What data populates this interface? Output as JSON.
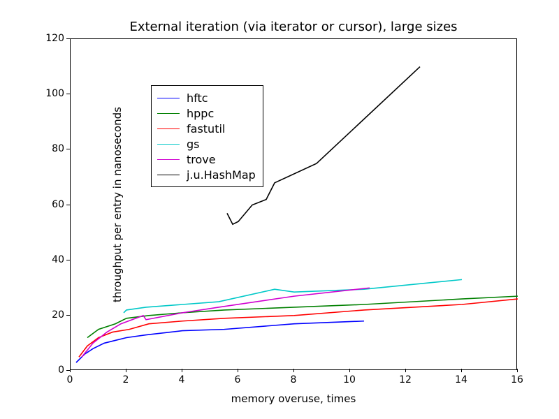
{
  "chart_data": {
    "type": "line",
    "title": "External iteration (via iterator or cursor), large sizes",
    "xlabel": "memory overuse, times",
    "ylabel": "throughput per entry in nanoseconds",
    "xlim": [
      0,
      16
    ],
    "ylim": [
      0,
      120
    ],
    "xticks": [
      0,
      2,
      4,
      6,
      8,
      10,
      12,
      14,
      16
    ],
    "yticks": [
      0,
      20,
      40,
      60,
      80,
      100,
      120
    ],
    "series": [
      {
        "name": "hftc",
        "color": "#0000ff",
        "x": [
          0.2,
          0.5,
          0.8,
          1.2,
          1.6,
          2.0,
          2.7,
          4.0,
          5.5,
          8.0,
          10.5
        ],
        "y": [
          3,
          6,
          8,
          10,
          11,
          12,
          13,
          14.5,
          15,
          17,
          18
        ]
      },
      {
        "name": "hppc",
        "color": "#008000",
        "x": [
          0.6,
          1.0,
          1.6,
          2.0,
          2.8,
          4.0,
          5.5,
          8.0,
          10.5,
          14.0,
          16.0
        ],
        "y": [
          12,
          15,
          17,
          19,
          20,
          21,
          22,
          23,
          24,
          26,
          27
        ]
      },
      {
        "name": "fastutil",
        "color": "#ff0000",
        "x": [
          0.3,
          0.6,
          1.0,
          1.5,
          2.1,
          2.8,
          4.0,
          5.5,
          8.0,
          10.5,
          14.0,
          16.0
        ],
        "y": [
          5,
          9,
          12,
          14,
          15,
          17,
          18,
          19,
          20,
          22,
          24,
          26
        ]
      },
      {
        "name": "gs",
        "color": "#00c8c8",
        "x": [
          1.9,
          2.0,
          2.7,
          4.0,
          5.3,
          7.3,
          8.0,
          10.5,
          14.0
        ],
        "y": [
          21,
          22,
          23,
          24,
          25,
          29.5,
          28.5,
          29.5,
          33
        ]
      },
      {
        "name": "trove",
        "color": "#d000d0",
        "x": [
          0.4,
          0.8,
          1.3,
          1.8,
          2.6,
          2.7,
          4.0,
          5.3,
          8.0,
          10.7
        ],
        "y": [
          5,
          10,
          14,
          17,
          20,
          18.5,
          21,
          23,
          27,
          30
        ]
      },
      {
        "name": "j.u.HashMap",
        "color": "#000000",
        "x": [
          5.6,
          5.8,
          6.0,
          6.5,
          7.0,
          7.3,
          8.8,
          12.5
        ],
        "y": [
          57,
          53,
          54,
          60,
          62,
          68,
          75,
          110
        ]
      }
    ]
  }
}
